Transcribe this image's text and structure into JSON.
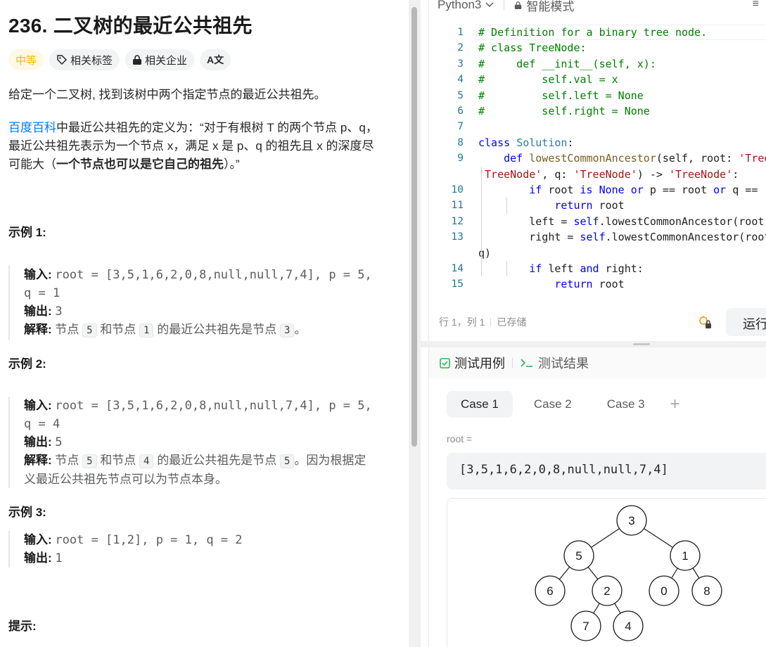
{
  "problem": {
    "title": "236. 二叉树的最近公共祖先",
    "tags": {
      "difficulty": "中等",
      "topics": "相关标签",
      "companies": "相关企业",
      "translate": "A文"
    },
    "description": "给定一个二叉树, 找到该树中两个指定节点的最近公共祖先。",
    "definition_link": "百度百科",
    "definition_part1": "中最近公共祖先的定义为：“对于有根树 T 的两个节点 p、q，",
    "definition_part2": "最近公共祖先表示为一个节点 x，满足 x 是 p、q 的祖先且 x 的深度尽",
    "definition_part3": "可能大（",
    "definition_bold": "一个节点也可以是它自己的祖先",
    "definition_end": "）。”",
    "examples": [
      {
        "heading": "示例 1:",
        "input_label": "输入:",
        "input_line1": "root = [3,5,1,6,2,0,8,null,null,7,4], p = 5,",
        "input_line2": "q = 1",
        "output_label": "输出:",
        "output": "3",
        "explain_label": "解释:",
        "explain_a": "节点",
        "explain_chip1": "5",
        "explain_b": "和节点",
        "explain_chip2": "1",
        "explain_c": "的最近公共祖先是节点",
        "explain_chip3": "3",
        "explain_d": "。"
      },
      {
        "heading": "示例 2:",
        "input_label": "输入:",
        "input_line1": "root = [3,5,1,6,2,0,8,null,null,7,4], p = 5,",
        "input_line2": "q = 4",
        "output_label": "输出:",
        "output": "5",
        "explain_label": "解释:",
        "explain_a": "节点",
        "explain_chip1": "5",
        "explain_b": "和节点",
        "explain_chip2": "4",
        "explain_c": "的最近公共祖先是节点",
        "explain_chip3": "5",
        "explain_d": "。因为根据定",
        "explain_e": "义最近公共祖先节点可以为节点本身。"
      },
      {
        "heading": "示例 3:",
        "input_label": "输入:",
        "input_line1": "root = [1,2], p = 1, q = 2",
        "output_label": "输出:",
        "output": "1"
      }
    ],
    "hints_heading": "提示:"
  },
  "editor": {
    "language": "Python3",
    "mode": "智能模式",
    "menu": "≡",
    "lines": [
      {
        "n": "1",
        "html": "<span class=\"cm\"># Definition for a binary tree node.</span>"
      },
      {
        "n": "2",
        "html": "<span class=\"cm\"># class TreeNode:</span>"
      },
      {
        "n": "3",
        "html": "<span class=\"cm\">#     def __init__(self, x):</span>"
      },
      {
        "n": "4",
        "html": "<span class=\"cm\">#         self.val = x</span>"
      },
      {
        "n": "5",
        "html": "<span class=\"cm\">#         self.left = None</span>"
      },
      {
        "n": "6",
        "html": "<span class=\"cm\">#         self.right = None</span>"
      },
      {
        "n": "7",
        "html": ""
      },
      {
        "n": "8",
        "html": "<span class=\"kw\">class</span> <span class=\"cls\">Solution</span>:"
      },
      {
        "n": "9",
        "html": "    <span class=\"kw\">def</span> <span class=\"fn\">lowestCommonAncestor</span>(self, root: <span class=\"st\">'TreeNode'</span>, p:"
      },
      {
        "n": "",
        "html": "<span class=\"st\">'TreeNode'</span>, q: <span class=\"st\">'TreeNode'</span>) -> <span class=\"st\">'TreeNode'</span>:",
        "cont": true
      },
      {
        "n": "10",
        "html": "        <span class=\"kw\">if</span> root <span class=\"kw\">is</span> <span class=\"kw\">None</span> <span class=\"kw\">or</span> p == root <span class=\"kw\">or</span> q == root:"
      },
      {
        "n": "11",
        "html": "            <span class=\"kw\">return</span> root"
      },
      {
        "n": "12",
        "html": "        left = <span class=\"slf\">self</span>.lowestCommonAncestor(root.left, p, q)"
      },
      {
        "n": "13",
        "html": "        right = <span class=\"slf\">self</span>.lowestCommonAncestor(root.right, p,"
      },
      {
        "n": "",
        "html": "q)",
        "cont": true
      },
      {
        "n": "14",
        "html": "        <span class=\"kw\">if</span> left <span class=\"kw\">and</span> right:"
      },
      {
        "n": "15",
        "html": "            <span class=\"kw\">return</span> root"
      }
    ],
    "status_position": "行 1，列 1",
    "status_saved": "已存储",
    "run_label": "运行"
  },
  "testcases": {
    "tab_cases": "测试用例",
    "tab_results": "测试结果",
    "cases": [
      "Case 1",
      "Case 2",
      "Case 3"
    ],
    "add": "+",
    "root_label": "root =",
    "root_value": "[3,5,1,6,2,0,8,null,null,7,4]",
    "tree_nodes": [
      "3",
      "5",
      "1",
      "6",
      "2",
      "0",
      "8",
      "7",
      "4"
    ]
  },
  "colors": {
    "accent_link": "#007aff",
    "difficulty_medium": "#ffb800",
    "testcase_check": "#2db55d"
  }
}
